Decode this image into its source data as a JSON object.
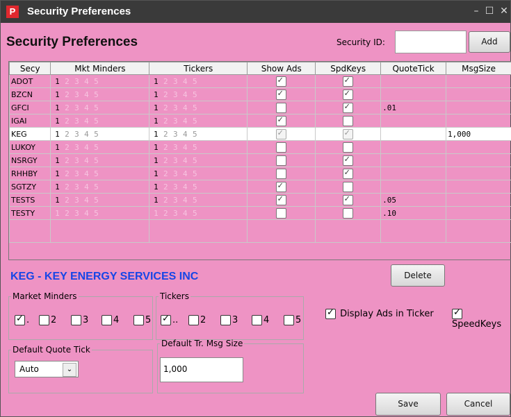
{
  "window": {
    "title": "Security Preferences",
    "app_icon": "P",
    "min_symbol": "–",
    "max_symbol": "☐",
    "close_symbol": "✕"
  },
  "header": {
    "title": "Security Preferences",
    "security_id_label": "Security ID:",
    "security_id_value": "",
    "add_label": "Add"
  },
  "grid": {
    "columns": [
      "Secy",
      "Mkt Minders",
      "Tickers",
      "Show Ads",
      "SpdKeys",
      "QuoteTick",
      "MsgSize"
    ],
    "level_numbers": [
      "1",
      "2",
      "3",
      "4",
      "5"
    ],
    "rows": [
      {
        "secy": "ADOT",
        "mm": 1,
        "tk": 1,
        "ads": true,
        "spd": true,
        "qt": "",
        "ms": ""
      },
      {
        "secy": "BZCN",
        "mm": 1,
        "tk": 1,
        "ads": true,
        "spd": true,
        "qt": "",
        "ms": ""
      },
      {
        "secy": "GFCI",
        "mm": 1,
        "tk": 1,
        "ads": false,
        "spd": true,
        "qt": ".01",
        "ms": ""
      },
      {
        "secy": "IGAI",
        "mm": 1,
        "tk": 1,
        "ads": true,
        "spd": false,
        "qt": "",
        "ms": ""
      },
      {
        "secy": "KEG",
        "mm": 1,
        "tk": 1,
        "ads": true,
        "spd": true,
        "qt": "",
        "ms": "1,000",
        "selected": true
      },
      {
        "secy": "LUKOY",
        "mm": 1,
        "tk": 1,
        "ads": false,
        "spd": false,
        "qt": "",
        "ms": ""
      },
      {
        "secy": "NSRGY",
        "mm": 1,
        "tk": 1,
        "ads": false,
        "spd": true,
        "qt": "",
        "ms": ""
      },
      {
        "secy": "RHHBY",
        "mm": 1,
        "tk": 1,
        "ads": false,
        "spd": true,
        "qt": "",
        "ms": ""
      },
      {
        "secy": "SGTZY",
        "mm": 1,
        "tk": 1,
        "ads": true,
        "spd": false,
        "qt": "",
        "ms": ""
      },
      {
        "secy": "TESTS",
        "mm": 1,
        "tk": 1,
        "ads": true,
        "spd": true,
        "qt": ".05",
        "ms": ""
      },
      {
        "secy": "TESTY",
        "mm": 0,
        "tk": 0,
        "ads": false,
        "spd": false,
        "qt": ".10",
        "ms": ""
      }
    ]
  },
  "detail": {
    "company": "KEG - KEY ENERGY SERVICES INC",
    "delete_label": "Delete",
    "market_minders": {
      "legend": "Market Minders",
      "items": [
        {
          "label": ".",
          "checked": true
        },
        {
          "label": "2",
          "checked": false
        },
        {
          "label": "3",
          "checked": false
        },
        {
          "label": "4",
          "checked": false
        },
        {
          "label": "5",
          "checked": false
        }
      ]
    },
    "tickers": {
      "legend": "Tickers",
      "items": [
        {
          "label": "..",
          "checked": true
        },
        {
          "label": "2",
          "checked": false
        },
        {
          "label": "3",
          "checked": false
        },
        {
          "label": "4",
          "checked": false
        },
        {
          "label": "5",
          "checked": false
        }
      ]
    },
    "display_ads_label": "Display Ads in Ticker",
    "display_ads_checked": true,
    "speedkeys_label": "SpeedKeys",
    "speedkeys_checked": true,
    "quote_tick": {
      "legend": "Default Quote Tick",
      "value": "Auto"
    },
    "msg_size": {
      "legend": "Default Tr. Msg Size",
      "value": "1,000"
    },
    "save_label": "Save",
    "cancel_label": "Cancel"
  }
}
